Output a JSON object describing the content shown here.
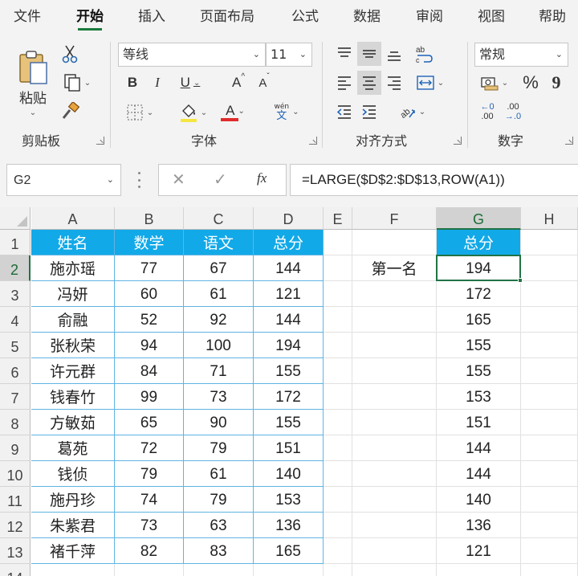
{
  "menu": {
    "tabs": [
      {
        "label": "文件",
        "active": false
      },
      {
        "label": "开始",
        "active": true
      },
      {
        "label": "插入",
        "active": false
      },
      {
        "label": "页面布局",
        "active": false
      },
      {
        "label": "公式",
        "active": false
      },
      {
        "label": "数据",
        "active": false
      },
      {
        "label": "审阅",
        "active": false
      },
      {
        "label": "视图",
        "active": false
      },
      {
        "label": "帮助",
        "active": false
      }
    ]
  },
  "ribbon": {
    "clipboard": {
      "label": "剪贴板",
      "paste_label": "粘贴"
    },
    "font": {
      "label": "字体",
      "font_name": "等线",
      "font_size": "11",
      "bold": "B",
      "italic": "I",
      "underline": "U",
      "grow": "A",
      "shrink": "A",
      "font_color": "A",
      "phonetic_top": "wén",
      "phonetic_bottom": "文"
    },
    "alignment": {
      "label": "对齐方式"
    },
    "number": {
      "label": "数字",
      "format": "常规",
      "percent": "%",
      "comma": "9",
      "inc_top": "←0",
      "inc_bottom": ".00",
      "dec_top": ".00",
      "dec_bottom": "→.0"
    }
  },
  "formula_bar": {
    "name_box": "G2",
    "formula": "=LARGE($D$2:$D$13,ROW(A1))",
    "cancel": "✕",
    "enter": "✓",
    "fx": "fx"
  },
  "sheet": {
    "columns": [
      "A",
      "B",
      "C",
      "D",
      "E",
      "F",
      "G",
      "H"
    ],
    "rows": [
      "1",
      "2",
      "3",
      "4",
      "5",
      "6",
      "7",
      "8",
      "9",
      "10",
      "11",
      "12",
      "13",
      "14"
    ],
    "selected_cell": "G2",
    "table_headers": [
      "姓名",
      "数学",
      "语文",
      "总分"
    ],
    "table_rows": [
      [
        "施亦瑶",
        "77",
        "67",
        "144"
      ],
      [
        "冯妍",
        "60",
        "61",
        "121"
      ],
      [
        "俞融",
        "52",
        "92",
        "144"
      ],
      [
        "张秋荣",
        "94",
        "100",
        "194"
      ],
      [
        "许元群",
        "84",
        "71",
        "155"
      ],
      [
        "钱春竹",
        "99",
        "73",
        "172"
      ],
      [
        "方敏茹",
        "65",
        "90",
        "155"
      ],
      [
        "葛苑",
        "72",
        "79",
        "151"
      ],
      [
        "钱侦",
        "79",
        "61",
        "140"
      ],
      [
        "施丹珍",
        "74",
        "79",
        "153"
      ],
      [
        "朱紫君",
        "73",
        "63",
        "136"
      ],
      [
        "褚千萍",
        "82",
        "83",
        "165"
      ]
    ],
    "f2_label": "第一名",
    "g_header": "总分",
    "g_values": [
      "194",
      "172",
      "165",
      "155",
      "155",
      "153",
      "151",
      "144",
      "144",
      "140",
      "136",
      "121"
    ]
  },
  "colors": {
    "table_header_bg": "#12a9e8",
    "table_border": "#5fb4e3",
    "selection": "#217346",
    "accent": "#1a7a3c"
  }
}
